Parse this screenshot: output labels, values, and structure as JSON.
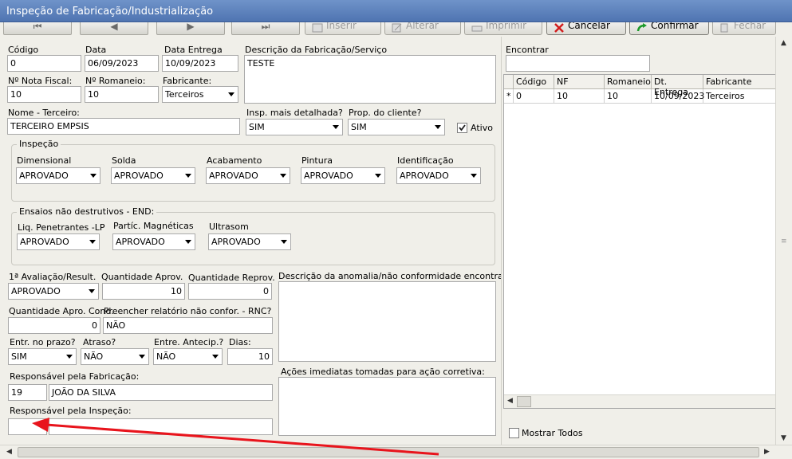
{
  "window": {
    "title": "Inspeção de Fabricação/Industrialização"
  },
  "toolbar": {
    "nav": [
      "⏮",
      "◀",
      "▶",
      "⏭"
    ],
    "buttons": {
      "inserir": "Inserir",
      "alterar": "Alterar",
      "imprimir": "Imprimir",
      "cancelar": "Cancelar",
      "confirmar": "Confirmar",
      "fechar": "Fechar"
    }
  },
  "form": {
    "codigo_label": "Código",
    "codigo": "0",
    "data_label": "Data",
    "data": "06/09/2023",
    "data_entrega_label": "Data Entrega",
    "data_entrega": "10/09/2023",
    "descricao_label": "Descrição da Fabricação/Serviço",
    "descricao": "TESTE",
    "nota_fiscal_label": "Nº Nota Fiscal:",
    "nota_fiscal": "10",
    "romaneio_label": "Nº Romaneio:",
    "romaneio": "10",
    "fabricante_label": "Fabricante:",
    "fabricante": "Terceiros",
    "terceiro_label": "Nome - Terceiro:",
    "terceiro": "TERCEIRO EMPSIS",
    "insp_detalhada_label": "Insp. mais detalhada?",
    "insp_detalhada": "SIM",
    "prop_cliente_label": "Prop. do cliente?",
    "prop_cliente": "SIM",
    "ativo_label": "Ativo",
    "ativo": "checked",
    "inspecao": {
      "title": "Inspeção",
      "items": [
        {
          "label": "Dimensional",
          "value": "APROVADO"
        },
        {
          "label": "Solda",
          "value": "APROVADO"
        },
        {
          "label": "Acabamento",
          "value": "APROVADO"
        },
        {
          "label": "Pintura",
          "value": "APROVADO"
        },
        {
          "label": "Identificação",
          "value": "APROVADO"
        }
      ]
    },
    "ensaios": {
      "title": "Ensaios não destrutivos - END:",
      "items": [
        {
          "label": "Liq. Penetrantes -LP",
          "value": "APROVADO"
        },
        {
          "label": "Partíc. Magnéticas",
          "value": "APROVADO"
        },
        {
          "label": "Ultrasom",
          "value": "APROVADO"
        }
      ]
    },
    "avaliacao_label": "1ª Avaliação/Result.",
    "avaliacao": "APROVADO",
    "qtd_aprov_label": "Quantidade Aprov.",
    "qtd_aprov": "10",
    "qtd_reprov_label": "Quantidade Reprov.",
    "qtd_reprov": "0",
    "anomalia_label": "Descrição da anomalia/não conformidade encontrada:",
    "qtd_apro_cond_label": "Quantidade Apro. Cond.",
    "qtd_apro_cond": "0",
    "rnc_label": "Preencher relatório não confor. - RNC?",
    "rnc": "NÃO",
    "entr_prazo_label": "Entr. no prazo?",
    "entr_prazo": "SIM",
    "atraso_label": "Atraso?",
    "atraso": "NÃO",
    "entr_antecip_label": "Entre. Antecip.?",
    "entr_antecip": "NÃO",
    "dias_label": "Dias:",
    "dias": "10",
    "acoes_label": "Ações imediatas tomadas para ação corretiva:",
    "resp_fabricacao_label": "Responsável pela Fabricação:",
    "resp_fabricacao_cod": "19",
    "resp_fabricacao_nome": "JOÃO DA SILVA",
    "resp_inspecao_label": "Responsável pela Inspeção:",
    "resp_inspecao_cod": "",
    "resp_inspecao_nome": ""
  },
  "right": {
    "encontrar_label": "Encontrar",
    "encontrar": "",
    "columns": [
      "Código",
      "NF",
      "Romaneio",
      "Dt. Entrega",
      "Fabricante"
    ],
    "rows": [
      {
        "marker": "*",
        "codigo": "0",
        "nf": "10",
        "romaneio": "10",
        "dt_entrega": "10/09/2023",
        "fabricante": "Terceiros"
      }
    ],
    "mostrar_todos_label": "Mostrar Todos"
  },
  "colors": {
    "title_bar": "#4f74b1",
    "annotation_arrow": "#e8141c"
  }
}
